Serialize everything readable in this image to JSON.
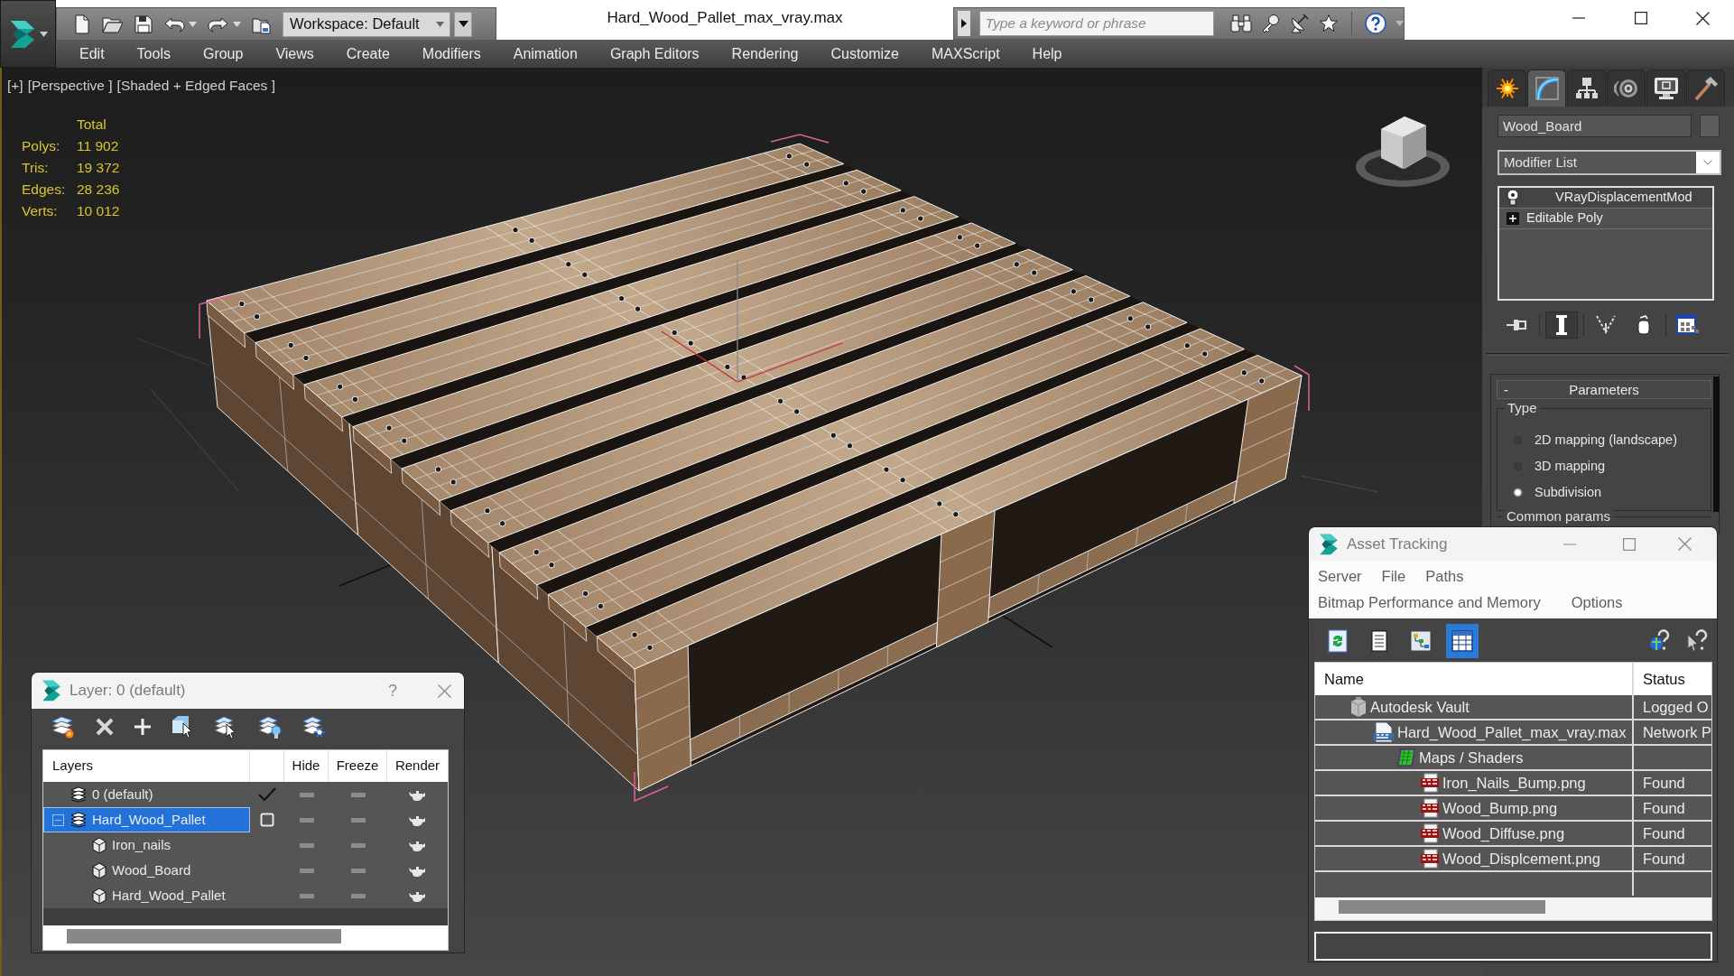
{
  "app_bar": {
    "workspace": "Workspace: Default",
    "title": "Hard_Wood_Pallet_max_vray.max",
    "search": {
      "placeholder": "Type a keyword or phrase"
    }
  },
  "menu": [
    "Edit",
    "Tools",
    "Group",
    "Views",
    "Create",
    "Modifiers",
    "Animation",
    "Graph Editors",
    "Rendering",
    "Customize",
    "MAXScript",
    "Help"
  ],
  "viewport": {
    "labels": [
      "[+]",
      "[Perspective ]",
      "[Shaded + Edged Faces ]"
    ],
    "statistics": {
      "heading": "Total",
      "rows": [
        {
          "label": "Polys:",
          "value": "11 902"
        },
        {
          "label": "Tris:",
          "value": "19 372"
        },
        {
          "label": "Edges:",
          "value": "28 236"
        },
        {
          "label": "Verts:",
          "value": "10 012"
        }
      ]
    }
  },
  "command_panel": {
    "tabs": [
      {
        "kind": "create",
        "selected": false
      },
      {
        "kind": "modify",
        "selected": true
      },
      {
        "kind": "hierarchy",
        "selected": false
      },
      {
        "kind": "motion",
        "selected": false
      },
      {
        "kind": "display",
        "selected": false
      },
      {
        "kind": "utilities",
        "selected": false
      }
    ],
    "object_name": "Wood_Board",
    "modifier_list": "Modifier List",
    "stack": [
      {
        "kind": "modifier",
        "label": "VRayDisplacementMod",
        "on": true
      },
      {
        "kind": "object",
        "label": "Editable Poly",
        "expanded": false
      }
    ],
    "stack_tools": [
      {
        "kind": "pin",
        "pressed": false
      },
      {
        "kind": "end-result",
        "pressed": true
      },
      {
        "kind": "make-unique",
        "pressed": false
      },
      {
        "kind": "remove",
        "pressed": false
      },
      {
        "kind": "configure",
        "pressed": false
      }
    ],
    "rollout": {
      "sign": "-",
      "title": "Parameters",
      "group": "Type",
      "options": [
        {
          "label": "2D mapping (landscape)",
          "selected": false
        },
        {
          "label": "3D mapping",
          "selected": false
        },
        {
          "label": "Subdivision",
          "selected": true
        }
      ],
      "next_group": "Common params"
    }
  },
  "layer_dialog": {
    "title": "Layer: 0 (default)",
    "help": "?",
    "columns": {
      "layers": "Layers",
      "hide": "Hide",
      "freeze": "Freeze",
      "render": "Render"
    },
    "rows": [
      {
        "kind": "layer",
        "label": "0 (default)",
        "current": true,
        "selected": false,
        "hidden": false,
        "frozen": false,
        "renderable": true
      },
      {
        "kind": "layer",
        "label": "Hard_Wood_Pallet",
        "current": false,
        "selected": true,
        "expanded": true,
        "hidden": false,
        "frozen": false,
        "renderable": true,
        "children": [
          {
            "kind": "object",
            "label": "Iron_nails",
            "selected": false,
            "hidden": false,
            "frozen": false,
            "renderable": true
          },
          {
            "kind": "object",
            "label": "Wood_Board",
            "selected": false,
            "hidden": false,
            "frozen": false,
            "renderable": true
          },
          {
            "kind": "object",
            "label": "Hard_Wood_Pallet",
            "selected": false,
            "hidden": false,
            "frozen": false,
            "renderable": true
          }
        ]
      }
    ]
  },
  "asset_tracking": {
    "title": "Asset Tracking",
    "menu_rows": [
      [
        "Server",
        "File",
        "Paths"
      ],
      [
        "Bitmap Performance and Memory",
        "Options"
      ]
    ],
    "tools": [
      {
        "kind": "refresh",
        "selected": false
      },
      {
        "kind": "list",
        "selected": false
      },
      {
        "kind": "diagram",
        "selected": false
      },
      {
        "kind": "table",
        "selected": true
      }
    ],
    "columns": {
      "name": "Name",
      "status": "Status"
    },
    "rows": [
      {
        "kind": "vault",
        "name": "Autodesk Vault",
        "status": "Logged O",
        "children": [
          {
            "kind": "max-file",
            "name": "Hard_Wood_Pallet_max_vray.max",
            "status": "Network P",
            "children": [
              {
                "kind": "folder",
                "name": "Maps / Shaders",
                "children": [
                  {
                    "kind": "png",
                    "name": "Iron_Nails_Bump.png",
                    "status": "Found"
                  },
                  {
                    "kind": "png",
                    "name": "Wood_Bump.png",
                    "status": "Found"
                  },
                  {
                    "kind": "png",
                    "name": "Wood_Diffuse.png",
                    "status": "Found"
                  },
                  {
                    "kind": "png",
                    "name": "Wood_Displcement.png",
                    "status": "Found"
                  }
                ]
              }
            ]
          }
        ]
      }
    ]
  }
}
